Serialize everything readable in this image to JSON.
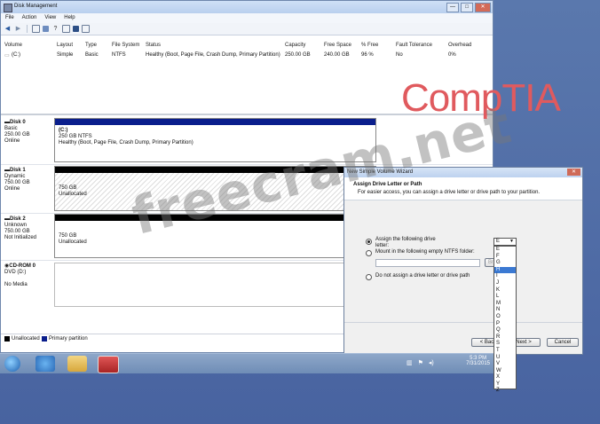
{
  "window": {
    "title": "Disk Management",
    "menu": [
      "File",
      "Action",
      "View",
      "Help"
    ],
    "controls": {
      "minimize": "—",
      "maximize": "□",
      "close": "✕"
    }
  },
  "toolbar": {
    "icons": [
      "back-arrow-icon",
      "forward-arrow-icon",
      "console-tree-icon",
      "properties-icon",
      "help-icon",
      "refresh-icon",
      "connect-icon",
      "settings-icon"
    ]
  },
  "volume_list": {
    "headers": [
      "Volume",
      "Layout",
      "Type",
      "File System",
      "Status",
      "Capacity",
      "Free Space",
      "% Free",
      "Fault Tolerance",
      "Overhead"
    ],
    "rows": [
      [
        "(C:)",
        "Simple",
        "Basic",
        "NTFS",
        "Healthy (Boot, Page File, Crash Dump, Primary Partition)",
        "250.00 GB",
        "240.00 GB",
        "96 %",
        "No",
        "0%"
      ]
    ]
  },
  "disks": [
    {
      "name": "Disk 0",
      "type": "Basic",
      "size": "250.00 GB",
      "state": "Online",
      "part_title": "(C:)",
      "part_line1": "250 GB NTFS",
      "part_line2": "Healthy (Boot, Page File, Crash Dump, Primary Partition)"
    },
    {
      "name": "Disk 1",
      "type": "Dynamic",
      "size": "750.00 GB",
      "state": "Online",
      "part_line1": "750 GB",
      "part_line2": "Unallocated"
    },
    {
      "name": "Disk 2",
      "type": "Unknown",
      "size": "750.00 GB",
      "state": "Not Initialized",
      "part_line1": "750 GB",
      "part_line2": "Unallocated"
    },
    {
      "name": "CD-ROM 0",
      "type": "DVD (D:)",
      "state": "No Media"
    }
  ],
  "legend": {
    "unallocated": "Unallocated",
    "primary": "Primary partition"
  },
  "wizard": {
    "title": "New Simple Volume Wizard",
    "heading": "Assign Drive Letter or Path",
    "subheading": "For easier access, you can assign a drive letter or drive path to your partition.",
    "option1_line1": "Assign the following drive",
    "option1_line2": "letter:",
    "option2": "Mount in the following empty NTFS folder:",
    "option3": "Do not assign a drive letter or drive path",
    "browse": "Br",
    "back": "< Back",
    "next": "Next >",
    "cancel": "Cancel"
  },
  "dropdown": {
    "selected": "E",
    "options": [
      "E",
      "F",
      "G",
      "H",
      "I",
      "J",
      "K",
      "L",
      "M",
      "N",
      "O",
      "P",
      "Q",
      "R",
      "S",
      "T",
      "U",
      "V",
      "W",
      "X",
      "Y",
      "Z"
    ]
  },
  "watermarks": {
    "brand": "CompTIA",
    "site": "freecram.net"
  },
  "taskbar": {
    "time": "5:3 PM",
    "date": "7/31/2015"
  }
}
